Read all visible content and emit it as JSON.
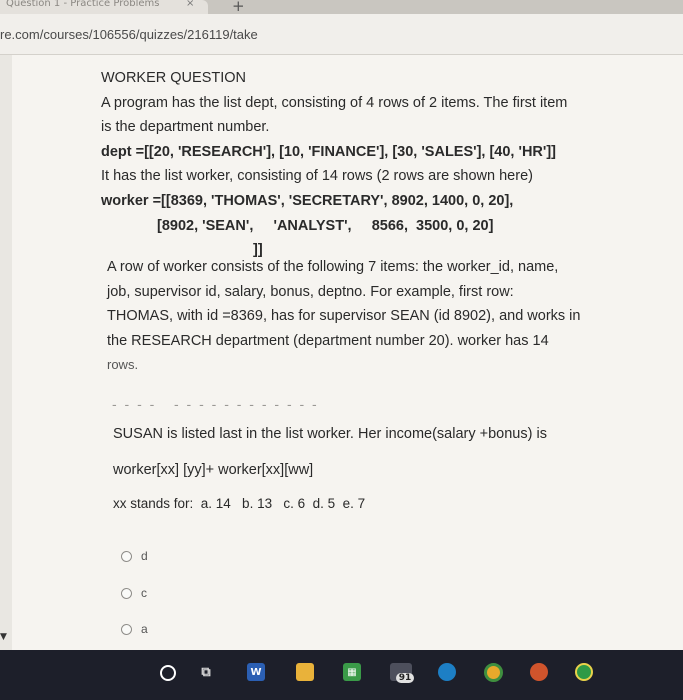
{
  "browser": {
    "tab_title": "Question 1 - Practice Problems",
    "tab_close": "×",
    "new_tab": "+",
    "url": "re.com/courses/106556/quizzes/216119/take"
  },
  "question": {
    "heading": "WORKER QUESTION",
    "intro_line1": "A program has the list dept, consisting of 4 rows of 2 items. The first item",
    "intro_line2": "is the department number.",
    "dept_line": "dept =[[20, 'RESEARCH'], [10, 'FINANCE'], [30, 'SALES'], [40, 'HR']]",
    "worker_intro": "It has the list worker, consisting of 14 rows (2 rows are shown here)",
    "worker_line1": "worker =[[8369, 'THOMAS', 'SECRETARY', 8902, 1400, 0, 20],",
    "worker_line2": "[8902, 'SEAN',     'ANALYST',     8566,  3500, 0, 20]",
    "worker_close": "]]",
    "desc_line1": "A row of worker consists of the following 7 items: the worker_id, name,",
    "desc_line2": "job, supervisor id, salary, bonus, deptno.  For example, first row:",
    "desc_line3": "THOMAS, with id =8369, has for supervisor SEAN (id 8902), and works in",
    "desc_line4": "the RESEARCH department (department number 20).  worker has 14",
    "desc_line5": "rows.",
    "separator": "- - - -   - - - - - - - - - - - -",
    "susan_line": "SUSAN is listed last in the list worker.  Her income(salary +bonus) is",
    "formula": "worker[xx] [yy]+ worker[xx][ww]",
    "xx_line": "xx stands for:  a. 14   b. 13   c. 6  d. 5  e. 7"
  },
  "options": [
    {
      "label": "d"
    },
    {
      "label": "c"
    },
    {
      "label": "a"
    }
  ],
  "taskbar": {
    "badge_count": "91"
  }
}
